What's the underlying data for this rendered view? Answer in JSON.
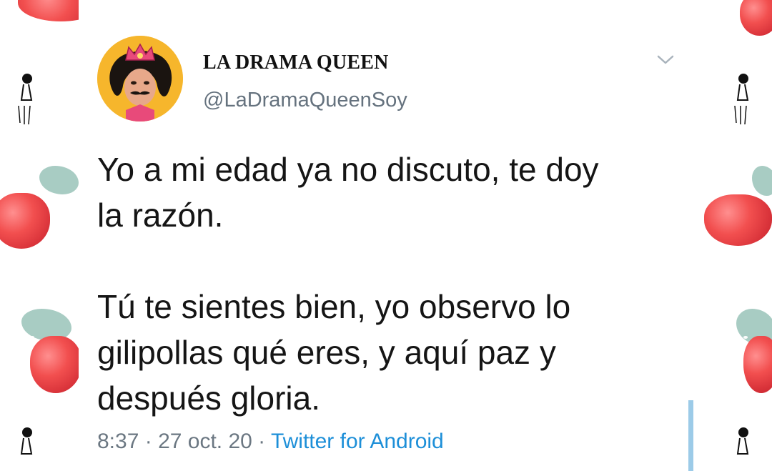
{
  "tweet": {
    "display_name": "LA DRAMA QUEEN",
    "handle": "@LaDramaQueenSoy",
    "text": "Yo a mi edad ya no discuto, te doy\nla razón.\n\nTú te sientes bien, yo observo lo\ngilipollas qué eres, y aquí paz y\ndespués gloria.",
    "time": "8:37",
    "separator": " · ",
    "date": "27 oct. 20",
    "source": "Twitter for Android"
  },
  "icons": {
    "avatar": "avatar-icon",
    "more": "chevron-down-icon"
  },
  "colors": {
    "avatar_bg": "#f6b62c",
    "handle": "#65727e",
    "source_link": "#1d8fd8",
    "strawberry": "#e23b42",
    "leaf": "#9fc6bd",
    "reply_line": "#9ccbe8"
  }
}
